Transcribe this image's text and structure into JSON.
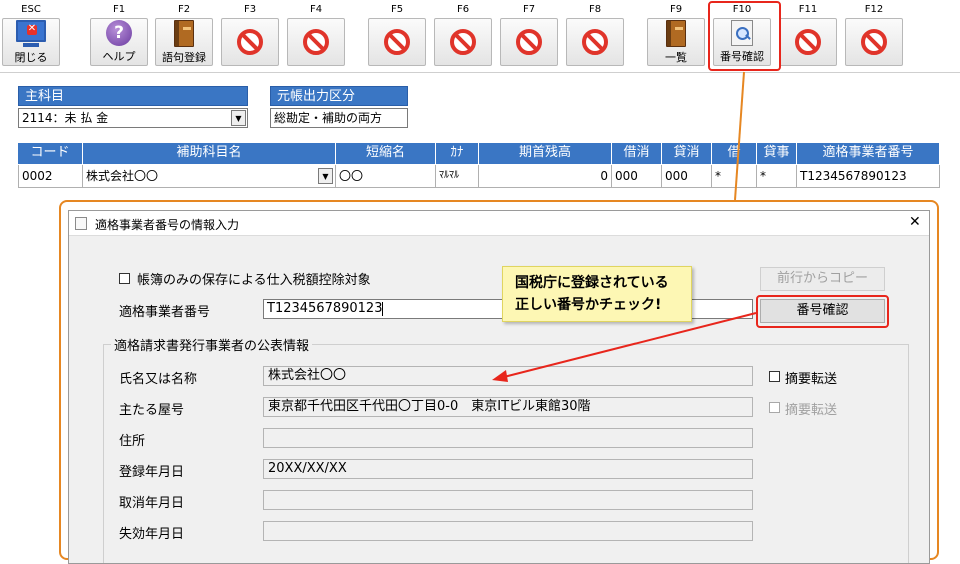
{
  "toolbar": {
    "keys": [
      "ESC",
      "F1",
      "F2",
      "F3",
      "F4",
      "F5",
      "F6",
      "F7",
      "F8",
      "F9",
      "F10",
      "F11",
      "F12"
    ],
    "close_label": "閉じる",
    "help_label": "ヘルプ",
    "phrase_label": "語句登録",
    "list_label": "一覧",
    "verify_label": "番号確認"
  },
  "header": {
    "main_subject_label": "主科目",
    "main_subject_value": "2114：未 払 金",
    "ledger_output_label": "元帳出力区分",
    "ledger_output_value": "総勘定・補助の両方"
  },
  "grid": {
    "columns": [
      "コード",
      "補助科目名",
      "短縮名",
      "ｶﾅ",
      "期首残高",
      "借消",
      "貸消",
      "借",
      "貸事",
      "適格事業者番号"
    ],
    "row": [
      "0002",
      "株式会社〇〇",
      "〇〇",
      "ﾏﾙﾏﾙ",
      "0",
      "000",
      "000",
      "*",
      "*",
      "T1234567890123"
    ]
  },
  "dialog": {
    "title": "適格事業者番号の情報入力",
    "close_glyph": "✕",
    "checkbox_label": "帳簿のみの保存による仕入税額控除対象",
    "copy_button": "前行からコピー",
    "number_label": "適格事業者番号",
    "number_value": "T1234567890123",
    "verify_button": "番号確認",
    "group_title": "適格請求書発行事業者の公表情報",
    "fields": [
      {
        "label": "氏名又は名称",
        "value": "株式会社〇〇"
      },
      {
        "label": "主たる屋号",
        "value": "東京都千代田区千代田〇丁目0-0　東京ITビル東館30階"
      },
      {
        "label": "住所",
        "value": ""
      },
      {
        "label": "登録年月日",
        "value": "20XX/XX/XX"
      },
      {
        "label": "取消年月日",
        "value": ""
      },
      {
        "label": "失効年月日",
        "value": ""
      }
    ],
    "summary_transfer_1": "摘要転送",
    "summary_transfer_2": "摘要転送"
  },
  "callout": {
    "line1": "国税庁に登録されている",
    "line2": "正しい番号かチェック!"
  },
  "colors": {
    "header_blue": "#3a76c4",
    "accent_orange": "#e68722",
    "highlight_red": "#e8261c",
    "callout_yellow": "#fdf7b4"
  }
}
